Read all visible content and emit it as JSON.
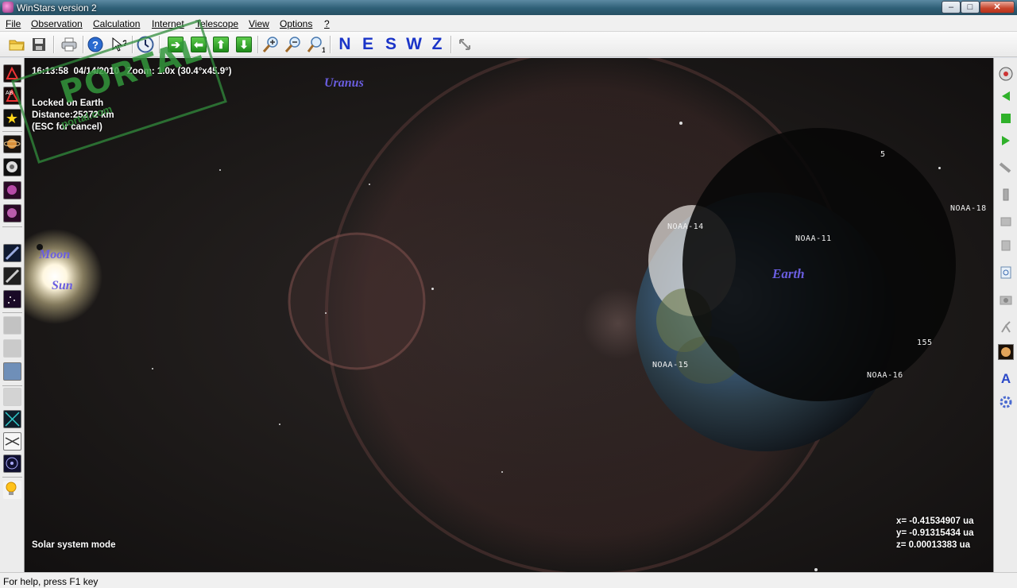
{
  "window": {
    "title": "WinStars version 2",
    "min": "–",
    "max": "□",
    "close": "✕"
  },
  "menu": [
    "File",
    "Observation",
    "Calculation",
    "Internet",
    "Telescope",
    "View",
    "Options",
    "?"
  ],
  "toolbar": {
    "compass": [
      "N",
      "E",
      "S",
      "W",
      "Z"
    ]
  },
  "hud": {
    "time": "16:13:58",
    "date": "04/14/2010",
    "zoom": "Zoom: 1.0x (30.4°x45.9°)",
    "lock_line1": "Locked on Earth",
    "lock_line2": "Distance:25272 km",
    "lock_line3": "(ESC for cancel)",
    "mode": "Solar system mode",
    "coord_x": "x= -0.41534907 ua",
    "coord_y": "y= -0.91315434 ua",
    "coord_z": "z= 0.00013383 ua"
  },
  "labels": {
    "uranus": "Uranus",
    "moon": "Moon",
    "sun": "Sun",
    "earth": "Earth"
  },
  "satellites": [
    "NOAA-14",
    "NOAA-11",
    "NOAA-18",
    "NOAA-15",
    "NOAA-16",
    "155",
    "5"
  ],
  "watermark": {
    "big": "PORTAL",
    "small": "portal.com"
  },
  "status": "For help, press F1 key",
  "colors": {
    "label": "#6a5ee0",
    "compass": "#1a34c8",
    "sky": "#1c1918"
  }
}
